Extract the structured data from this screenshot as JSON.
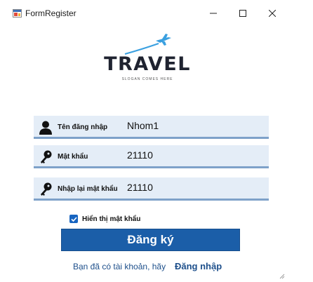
{
  "window": {
    "title": "FormRegister"
  },
  "logo": {
    "brand": "TRAVEL",
    "slogan": "SLOGAN COMES HERE"
  },
  "fields": [
    {
      "label": "Tên đăng nhập",
      "value": "Nhom1",
      "icon": "user-icon"
    },
    {
      "label": "Mật khẩu",
      "value": "21110",
      "icon": "key-icon"
    },
    {
      "label": "Nhập lại mật khẩu",
      "value": "21110",
      "icon": "key-icon"
    }
  ],
  "show_password": {
    "label": "Hiển thị mật khẩu",
    "checked": true
  },
  "register_button": {
    "label": "Đăng ký"
  },
  "footer": {
    "prompt": "Bạn đã có tài khoản, hãy",
    "login_link": "Đăng nhập"
  },
  "colors": {
    "field_bg": "#e4edf7",
    "field_underline": "#7ea1c9",
    "button_bg": "#1b5ea8",
    "link": "#1d4f8b",
    "logo_plane": "#3aa0e0"
  }
}
